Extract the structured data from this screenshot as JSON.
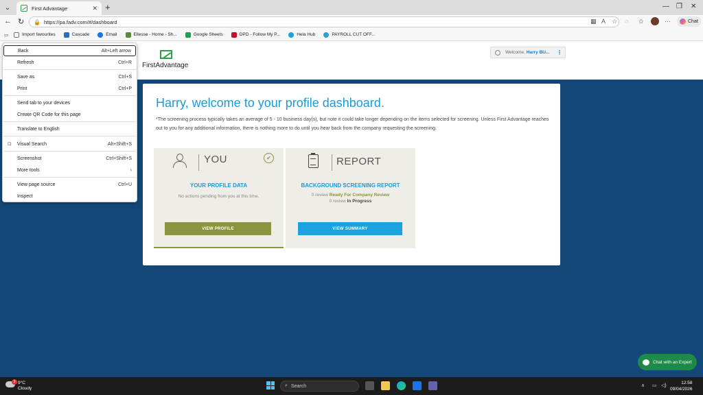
{
  "browser": {
    "tab_title": "First Advantage",
    "url": "https://pa.fadv.com/#/dashboard",
    "copilot_label": "Chat",
    "favourites": [
      {
        "label": "Import favourites",
        "color": "#777777"
      },
      {
        "label": "Cascade",
        "color": "#2a6fbf"
      },
      {
        "label": "Email",
        "color": "#1a73e8"
      },
      {
        "label": "Ellesse - Home - Sh...",
        "color": "#5b8a3a"
      },
      {
        "label": "Google Sheets",
        "color": "#1e9e4f"
      },
      {
        "label": "DPD - Follow My P...",
        "color": "#c8102e"
      },
      {
        "label": "Hela Hub",
        "color": "#1aa3df"
      },
      {
        "label": "PAYROLL CUT OFF...",
        "color": "#2a9fd6"
      }
    ]
  },
  "context_menu": {
    "items": [
      {
        "label": "Back",
        "shortcut": "Alt+Left arrow"
      },
      {
        "label": "Refresh",
        "shortcut": "Ctrl+R"
      },
      {
        "label": "Save as",
        "shortcut": "Ctrl+S"
      },
      {
        "label": "Print",
        "shortcut": "Ctrl+P"
      },
      {
        "label": "Send tab to your devices",
        "shortcut": ""
      },
      {
        "label": "Create QR Code for this page",
        "shortcut": ""
      },
      {
        "label": "Translate to English",
        "shortcut": ""
      },
      {
        "label": "Visual Search",
        "shortcut": "Alt+Shift+S"
      },
      {
        "label": "Screenshot",
        "shortcut": "Ctrl+Shift+S"
      },
      {
        "label": "More tools",
        "shortcut": "›"
      },
      {
        "label": "View page source",
        "shortcut": "Ctrl+U"
      },
      {
        "label": "Inspect",
        "shortcut": ""
      }
    ]
  },
  "site": {
    "logo_text": "FirstAdvantage",
    "welcome_prefix": "Welcome,",
    "welcome_name": "Harry BU...",
    "heading": "Harry, welcome to your profile dashboard.",
    "note": "*The screening process typically takes an average of 5 - 10 business day(s), but note it could take longer depending on the items selected for screening. Unless First Advantage reaches out to you for any additional information, there is nothing more to do until you hear back from the company requesting the screening.",
    "you_panel": {
      "title": "YOU",
      "subtitle": "YOUR PROFILE DATA",
      "desc": "No actions pending from you at this time.",
      "button": "VIEW PROFILE"
    },
    "report_panel": {
      "title": "REPORT",
      "subtitle": "BACKGROUND SCREENING REPORT",
      "line1_prefix": "0 review",
      "line1_status": "Ready For Company Review",
      "line2_prefix": "0 review",
      "line2_status": "In Progress",
      "button": "VIEW SUMMARY"
    },
    "chat_expert": "Chat with an Expert"
  },
  "taskbar": {
    "weather_temp": "9°C",
    "weather_desc": "Cloudy",
    "weather_badge": "3",
    "search_placeholder": "Search",
    "time": "12:58",
    "date": "09/04/2026"
  }
}
